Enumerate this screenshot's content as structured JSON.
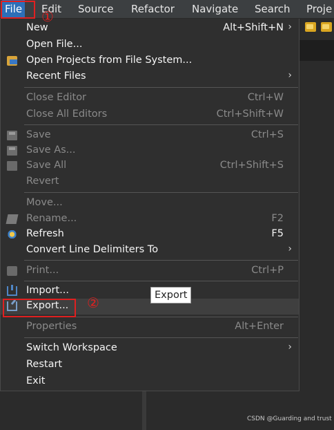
{
  "menubar": {
    "items": [
      "File",
      "Edit",
      "Source",
      "Refactor",
      "Navigate",
      "Search",
      "Proje"
    ]
  },
  "file_menu": {
    "items": [
      {
        "label": "New",
        "shortcut": "Alt+Shift+N",
        "submenu": true,
        "enabled": true
      },
      {
        "label": "Open File...",
        "shortcut": "",
        "enabled": true
      },
      {
        "label": "Open Projects from File System...",
        "shortcut": "",
        "enabled": true,
        "icon": "open-projects-icon"
      },
      {
        "label": "Recent Files",
        "shortcut": "",
        "submenu": true,
        "enabled": true
      },
      {
        "label": "Close Editor",
        "shortcut": "Ctrl+W",
        "enabled": false
      },
      {
        "label": "Close All Editors",
        "shortcut": "Ctrl+Shift+W",
        "enabled": false
      },
      {
        "label": "Save",
        "shortcut": "Ctrl+S",
        "enabled": false,
        "icon": "save-icon"
      },
      {
        "label": "Save As...",
        "shortcut": "",
        "enabled": false,
        "icon": "save-as-icon"
      },
      {
        "label": "Save All",
        "shortcut": "Ctrl+Shift+S",
        "enabled": false,
        "icon": "save-all-icon"
      },
      {
        "label": "Revert",
        "shortcut": "",
        "enabled": false
      },
      {
        "label": "Move...",
        "shortcut": "",
        "enabled": false
      },
      {
        "label": "Rename...",
        "shortcut": "F2",
        "enabled": false,
        "icon": "rename-icon"
      },
      {
        "label": "Refresh",
        "shortcut": "F5",
        "enabled": true,
        "icon": "refresh-icon"
      },
      {
        "label": "Convert Line Delimiters To",
        "shortcut": "",
        "submenu": true,
        "enabled": true
      },
      {
        "label": "Print...",
        "shortcut": "Ctrl+P",
        "enabled": false,
        "icon": "print-icon"
      },
      {
        "label": "Import...",
        "shortcut": "",
        "enabled": true,
        "icon": "import-icon"
      },
      {
        "label": "Export...",
        "shortcut": "",
        "enabled": true,
        "icon": "export-icon"
      },
      {
        "label": "Properties",
        "shortcut": "Alt+Enter",
        "enabled": false
      },
      {
        "label": "Switch Workspace",
        "shortcut": "",
        "submenu": true,
        "enabled": true
      },
      {
        "label": "Restart",
        "shortcut": "",
        "enabled": true
      },
      {
        "label": "Exit",
        "shortcut": "",
        "enabled": true
      }
    ]
  },
  "submenu_arrow": "›",
  "tooltip": "Export",
  "annotations": {
    "step1": "①",
    "step2": "②"
  },
  "watermark": "CSDN @Guarding and trust",
  "colors": {
    "menu_bg": "#2f2f2f",
    "highlight": "#2d6fb8",
    "annotation": "#e02020"
  }
}
